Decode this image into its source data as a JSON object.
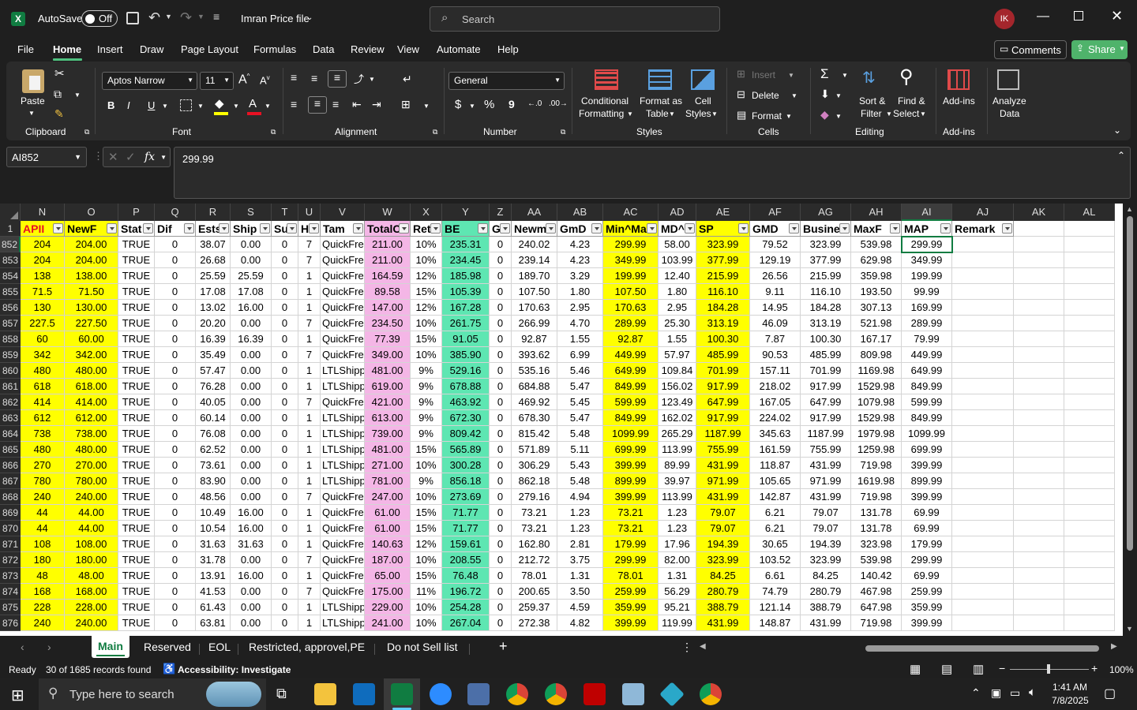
{
  "titlebar": {
    "autosave_label": "AutoSave",
    "autosave_state": "Off",
    "file_name": "Imran Price file",
    "search_placeholder": "Search",
    "user_initials": "IK"
  },
  "menu": {
    "items": [
      "File",
      "Home",
      "Insert",
      "Draw",
      "Page Layout",
      "Formulas",
      "Data",
      "Review",
      "View",
      "Automate",
      "Help"
    ],
    "active": "Home",
    "comments_label": "Comments",
    "share_label": "Share"
  },
  "ribbon": {
    "clipboard": {
      "paste": "Paste",
      "group": "Clipboard"
    },
    "font": {
      "name": "Aptos Narrow",
      "size": "11",
      "group": "Font",
      "bold": "B",
      "italic": "I",
      "underline": "U"
    },
    "alignment": {
      "group": "Alignment"
    },
    "number": {
      "format": "General",
      "group": "Number",
      "currency": "$",
      "percent": "%",
      "comma": "9"
    },
    "styles": {
      "conditional_1": "Conditional",
      "conditional_2": "Formatting",
      "format_as_table_1": "Format as",
      "format_as_table_2": "Table",
      "cell_styles_1": "Cell",
      "cell_styles_2": "Styles",
      "group": "Styles"
    },
    "cells": {
      "insert": "Insert",
      "delete": "Delete",
      "format": "Format",
      "group": "Cells"
    },
    "editing": {
      "sort_1": "Sort &",
      "sort_2": "Filter",
      "find_1": "Find &",
      "find_2": "Select",
      "group": "Editing"
    },
    "addins": {
      "addins": "Add-ins",
      "group": "Add-ins",
      "analyze_1": "Analyze",
      "analyze_2": "Data"
    }
  },
  "formula_bar": {
    "name_box": "AI852",
    "fx": "fx",
    "value": "299.99"
  },
  "grid": {
    "corner_row_label": "1",
    "columns": [
      {
        "letter": "N",
        "header": "APII",
        "fill": "#ffff00"
      },
      {
        "letter": "O",
        "header": "NewF",
        "fill": "#ffff00"
      },
      {
        "letter": "P",
        "header": "Stat",
        "fill": "#ffffff"
      },
      {
        "letter": "Q",
        "header": "Dif",
        "fill": "#ffffff"
      },
      {
        "letter": "R",
        "header": "Ests",
        "fill": "#ffffff"
      },
      {
        "letter": "S",
        "header": "Ship",
        "fill": "#ffffff"
      },
      {
        "letter": "T",
        "header": "Sui",
        "fill": "#ffffff"
      },
      {
        "letter": "U",
        "header": "H",
        "fill": "#ffffff"
      },
      {
        "letter": "V",
        "header": "Tam",
        "fill": "#ffffff"
      },
      {
        "letter": "W",
        "header": "TotalC",
        "fill": "#f4b6e6"
      },
      {
        "letter": "X",
        "header": "Ret",
        "fill": "#ffffff"
      },
      {
        "letter": "Y",
        "header": "BE",
        "fill": "#5ee6b2"
      },
      {
        "letter": "Z",
        "header": "GI",
        "fill": "#ffffff"
      },
      {
        "letter": "AA",
        "header": "Newm",
        "fill": "#ffffff"
      },
      {
        "letter": "AB",
        "header": "GmD",
        "fill": "#ffffff"
      },
      {
        "letter": "AC",
        "header": "Min^Ma",
        "fill": "#ffff00"
      },
      {
        "letter": "AD",
        "header": "MD^",
        "fill": "#ffffff"
      },
      {
        "letter": "AE",
        "header": "SP",
        "fill": "#ffff00"
      },
      {
        "letter": "AF",
        "header": "GMD",
        "fill": "#ffffff"
      },
      {
        "letter": "AG",
        "header": "Busines",
        "fill": "#ffffff"
      },
      {
        "letter": "AH",
        "header": "MaxF",
        "fill": "#ffffff"
      },
      {
        "letter": "AI",
        "header": "MAP",
        "fill": "#ffffff"
      },
      {
        "letter": "AJ",
        "header": "Remark",
        "fill": "#ffffff"
      },
      {
        "letter": "AK",
        "header": "",
        "fill": "#ffffff"
      },
      {
        "letter": "AL",
        "header": "",
        "fill": "#ffffff"
      }
    ],
    "rows": [
      {
        "n": "852",
        "c": [
          "204",
          "204.00",
          "TRUE",
          "0",
          "38.07",
          "0.00",
          "0",
          "7",
          "QuickFre",
          "211.00",
          "10%",
          "235.31",
          "0",
          "240.02",
          "4.23",
          "299.99",
          "58.00",
          "323.99",
          "79.52",
          "323.99",
          "539.98",
          "299.99"
        ]
      },
      {
        "n": "853",
        "c": [
          "204",
          "204.00",
          "TRUE",
          "0",
          "26.68",
          "0.00",
          "0",
          "7",
          "QuickFre",
          "211.00",
          "10%",
          "234.45",
          "0",
          "239.14",
          "4.23",
          "349.99",
          "103.99",
          "377.99",
          "129.19",
          "377.99",
          "629.98",
          "349.99"
        ]
      },
      {
        "n": "854",
        "c": [
          "138",
          "138.00",
          "TRUE",
          "0",
          "25.59",
          "25.59",
          "0",
          "1",
          "QuickFre",
          "164.59",
          "12%",
          "185.98",
          "0",
          "189.70",
          "3.29",
          "199.99",
          "12.40",
          "215.99",
          "26.56",
          "215.99",
          "359.98",
          "199.99"
        ]
      },
      {
        "n": "855",
        "c": [
          "71.5",
          "71.50",
          "TRUE",
          "0",
          "17.08",
          "17.08",
          "0",
          "1",
          "QuickFre",
          "89.58",
          "15%",
          "105.39",
          "0",
          "107.50",
          "1.80",
          "107.50",
          "1.80",
          "116.10",
          "9.11",
          "116.10",
          "193.50",
          "99.99"
        ]
      },
      {
        "n": "856",
        "c": [
          "130",
          "130.00",
          "TRUE",
          "0",
          "13.02",
          "16.00",
          "0",
          "1",
          "QuickFre",
          "147.00",
          "12%",
          "167.28",
          "0",
          "170.63",
          "2.95",
          "170.63",
          "2.95",
          "184.28",
          "14.95",
          "184.28",
          "307.13",
          "169.99"
        ]
      },
      {
        "n": "857",
        "c": [
          "227.5",
          "227.50",
          "TRUE",
          "0",
          "20.20",
          "0.00",
          "0",
          "7",
          "QuickFre",
          "234.50",
          "10%",
          "261.75",
          "0",
          "266.99",
          "4.70",
          "289.99",
          "25.30",
          "313.19",
          "46.09",
          "313.19",
          "521.98",
          "289.99"
        ]
      },
      {
        "n": "858",
        "c": [
          "60",
          "60.00",
          "TRUE",
          "0",
          "16.39",
          "16.39",
          "0",
          "1",
          "QuickFre",
          "77.39",
          "15%",
          "91.05",
          "0",
          "92.87",
          "1.55",
          "92.87",
          "1.55",
          "100.30",
          "7.87",
          "100.30",
          "167.17",
          "79.99"
        ]
      },
      {
        "n": "859",
        "c": [
          "342",
          "342.00",
          "TRUE",
          "0",
          "35.49",
          "0.00",
          "0",
          "7",
          "QuickFre",
          "349.00",
          "10%",
          "385.90",
          "0",
          "393.62",
          "6.99",
          "449.99",
          "57.97",
          "485.99",
          "90.53",
          "485.99",
          "809.98",
          "449.99"
        ]
      },
      {
        "n": "860",
        "c": [
          "480",
          "480.00",
          "TRUE",
          "0",
          "57.47",
          "0.00",
          "0",
          "1",
          "LTLShipp",
          "481.00",
          "9%",
          "529.16",
          "0",
          "535.16",
          "5.46",
          "649.99",
          "109.84",
          "701.99",
          "157.11",
          "701.99",
          "1169.98",
          "649.99"
        ]
      },
      {
        "n": "861",
        "c": [
          "618",
          "618.00",
          "TRUE",
          "0",
          "76.28",
          "0.00",
          "0",
          "1",
          "LTLShipp",
          "619.00",
          "9%",
          "678.88",
          "0",
          "684.88",
          "5.47",
          "849.99",
          "156.02",
          "917.99",
          "218.02",
          "917.99",
          "1529.98",
          "849.99"
        ]
      },
      {
        "n": "862",
        "c": [
          "414",
          "414.00",
          "TRUE",
          "0",
          "40.05",
          "0.00",
          "0",
          "7",
          "QuickFre",
          "421.00",
          "9%",
          "463.92",
          "0",
          "469.92",
          "5.45",
          "599.99",
          "123.49",
          "647.99",
          "167.05",
          "647.99",
          "1079.98",
          "599.99"
        ]
      },
      {
        "n": "863",
        "c": [
          "612",
          "612.00",
          "TRUE",
          "0",
          "60.14",
          "0.00",
          "0",
          "1",
          "LTLShipp",
          "613.00",
          "9%",
          "672.30",
          "0",
          "678.30",
          "5.47",
          "849.99",
          "162.02",
          "917.99",
          "224.02",
          "917.99",
          "1529.98",
          "849.99"
        ]
      },
      {
        "n": "864",
        "c": [
          "738",
          "738.00",
          "TRUE",
          "0",
          "76.08",
          "0.00",
          "0",
          "1",
          "LTLShipp",
          "739.00",
          "9%",
          "809.42",
          "0",
          "815.42",
          "5.48",
          "1099.99",
          "265.29",
          "1187.99",
          "345.63",
          "1187.99",
          "1979.98",
          "1099.99"
        ]
      },
      {
        "n": "865",
        "c": [
          "480",
          "480.00",
          "TRUE",
          "0",
          "62.52",
          "0.00",
          "0",
          "1",
          "LTLShipp",
          "481.00",
          "15%",
          "565.89",
          "0",
          "571.89",
          "5.11",
          "699.99",
          "113.99",
          "755.99",
          "161.59",
          "755.99",
          "1259.98",
          "699.99"
        ]
      },
      {
        "n": "866",
        "c": [
          "270",
          "270.00",
          "TRUE",
          "0",
          "73.61",
          "0.00",
          "0",
          "1",
          "LTLShipp",
          "271.00",
          "10%",
          "300.28",
          "0",
          "306.29",
          "5.43",
          "399.99",
          "89.99",
          "431.99",
          "118.87",
          "431.99",
          "719.98",
          "399.99"
        ]
      },
      {
        "n": "867",
        "c": [
          "780",
          "780.00",
          "TRUE",
          "0",
          "83.90",
          "0.00",
          "0",
          "1",
          "LTLShipp",
          "781.00",
          "9%",
          "856.18",
          "0",
          "862.18",
          "5.48",
          "899.99",
          "39.97",
          "971.99",
          "105.65",
          "971.99",
          "1619.98",
          "899.99"
        ]
      },
      {
        "n": "868",
        "c": [
          "240",
          "240.00",
          "TRUE",
          "0",
          "48.56",
          "0.00",
          "0",
          "7",
          "QuickFre",
          "247.00",
          "10%",
          "273.69",
          "0",
          "279.16",
          "4.94",
          "399.99",
          "113.99",
          "431.99",
          "142.87",
          "431.99",
          "719.98",
          "399.99"
        ]
      },
      {
        "n": "869",
        "c": [
          "44",
          "44.00",
          "TRUE",
          "0",
          "10.49",
          "16.00",
          "0",
          "1",
          "QuickFre",
          "61.00",
          "15%",
          "71.77",
          "0",
          "73.21",
          "1.23",
          "73.21",
          "1.23",
          "79.07",
          "6.21",
          "79.07",
          "131.78",
          "69.99"
        ]
      },
      {
        "n": "870",
        "c": [
          "44",
          "44.00",
          "TRUE",
          "0",
          "10.54",
          "16.00",
          "0",
          "1",
          "QuickFre",
          "61.00",
          "15%",
          "71.77",
          "0",
          "73.21",
          "1.23",
          "73.21",
          "1.23",
          "79.07",
          "6.21",
          "79.07",
          "131.78",
          "69.99"
        ]
      },
      {
        "n": "871",
        "c": [
          "108",
          "108.00",
          "TRUE",
          "0",
          "31.63",
          "31.63",
          "0",
          "1",
          "QuickFre",
          "140.63",
          "12%",
          "159.61",
          "0",
          "162.80",
          "2.81",
          "179.99",
          "17.96",
          "194.39",
          "30.65",
          "194.39",
          "323.98",
          "179.99"
        ]
      },
      {
        "n": "872",
        "c": [
          "180",
          "180.00",
          "TRUE",
          "0",
          "31.78",
          "0.00",
          "0",
          "7",
          "QuickFre",
          "187.00",
          "10%",
          "208.55",
          "0",
          "212.72",
          "3.75",
          "299.99",
          "82.00",
          "323.99",
          "103.52",
          "323.99",
          "539.98",
          "299.99"
        ]
      },
      {
        "n": "873",
        "c": [
          "48",
          "48.00",
          "TRUE",
          "0",
          "13.91",
          "16.00",
          "0",
          "1",
          "QuickFre",
          "65.00",
          "15%",
          "76.48",
          "0",
          "78.01",
          "1.31",
          "78.01",
          "1.31",
          "84.25",
          "6.61",
          "84.25",
          "140.42",
          "69.99"
        ]
      },
      {
        "n": "874",
        "c": [
          "168",
          "168.00",
          "TRUE",
          "0",
          "41.53",
          "0.00",
          "0",
          "7",
          "QuickFre",
          "175.00",
          "11%",
          "196.72",
          "0",
          "200.65",
          "3.50",
          "259.99",
          "56.29",
          "280.79",
          "74.79",
          "280.79",
          "467.98",
          "259.99"
        ]
      },
      {
        "n": "875",
        "c": [
          "228",
          "228.00",
          "TRUE",
          "0",
          "61.43",
          "0.00",
          "0",
          "1",
          "LTLShipp",
          "229.00",
          "10%",
          "254.28",
          "0",
          "259.37",
          "4.59",
          "359.99",
          "95.21",
          "388.79",
          "121.14",
          "388.79",
          "647.98",
          "359.99"
        ]
      },
      {
        "n": "876",
        "c": [
          "240",
          "240.00",
          "TRUE",
          "0",
          "63.81",
          "0.00",
          "0",
          "1",
          "LTLShipp",
          "241.00",
          "10%",
          "267.04",
          "0",
          "272.38",
          "4.82",
          "399.99",
          "119.99",
          "431.99",
          "148.87",
          "431.99",
          "719.98",
          "399.99"
        ]
      }
    ]
  },
  "sheets": {
    "tabs": [
      "Main",
      "Reserved",
      "EOL",
      "Restricted, approvel,PE",
      "Do not Sell list"
    ],
    "active": "Main"
  },
  "status": {
    "ready": "Ready",
    "records": "30 of 1685 records found",
    "accessibility": "Accessibility: Investigate",
    "zoom": "100%"
  },
  "taskbar": {
    "search_placeholder": "Type here to search",
    "time": "1:41 AM",
    "date": "7/8/2025"
  }
}
